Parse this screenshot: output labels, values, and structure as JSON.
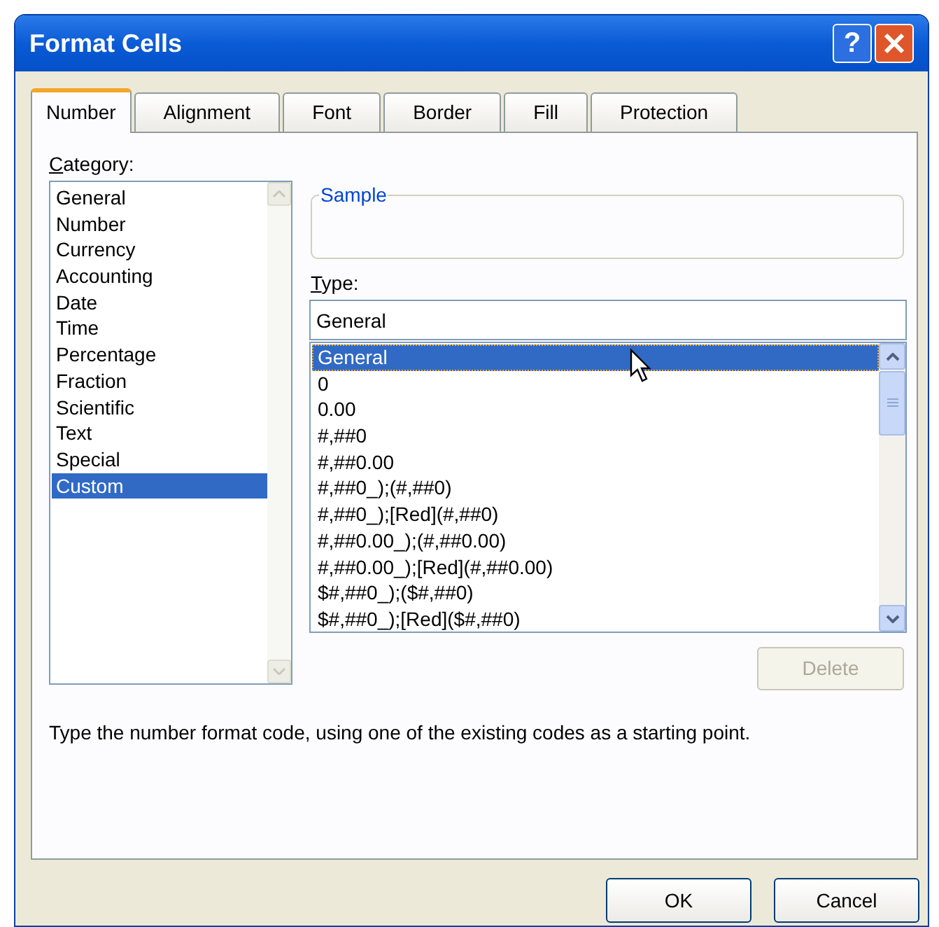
{
  "window": {
    "title": "Format Cells",
    "help_label": "?"
  },
  "tabs": [
    {
      "label": "Number",
      "selected": true
    },
    {
      "label": "Alignment",
      "selected": false
    },
    {
      "label": "Font",
      "selected": false
    },
    {
      "label": "Border",
      "selected": false
    },
    {
      "label": "Fill",
      "selected": false
    },
    {
      "label": "Protection",
      "selected": false
    }
  ],
  "category": {
    "label": "Category:",
    "items": [
      {
        "label": "General",
        "selected": false
      },
      {
        "label": "Number",
        "selected": false
      },
      {
        "label": "Currency",
        "selected": false
      },
      {
        "label": "Accounting",
        "selected": false
      },
      {
        "label": "Date",
        "selected": false
      },
      {
        "label": "Time",
        "selected": false
      },
      {
        "label": "Percentage",
        "selected": false
      },
      {
        "label": "Fraction",
        "selected": false
      },
      {
        "label": "Scientific",
        "selected": false
      },
      {
        "label": "Text",
        "selected": false
      },
      {
        "label": "Special",
        "selected": false
      },
      {
        "label": "Custom",
        "selected": true
      }
    ]
  },
  "sample": {
    "label": "Sample"
  },
  "type": {
    "label": "Type:",
    "value": "General",
    "items": [
      {
        "label": "General",
        "selected": true
      },
      {
        "label": "0",
        "selected": false
      },
      {
        "label": "0.00",
        "selected": false
      },
      {
        "label": "#,##0",
        "selected": false
      },
      {
        "label": "#,##0.00",
        "selected": false
      },
      {
        "label": "#,##0_);(#,##0)",
        "selected": false
      },
      {
        "label": "#,##0_);[Red](#,##0)",
        "selected": false
      },
      {
        "label": "#,##0.00_);(#,##0.00)",
        "selected": false
      },
      {
        "label": "#,##0.00_);[Red](#,##0.00)",
        "selected": false
      },
      {
        "label": "$#,##0_);($#,##0)",
        "selected": false
      },
      {
        "label": "$#,##0_);[Red]($#,##0)",
        "selected": false
      }
    ]
  },
  "delete_button": {
    "label": "Delete",
    "disabled": true
  },
  "description": "Type the number format code, using one of the existing codes as a starting point.",
  "buttons": [
    {
      "label": "OK"
    },
    {
      "label": "Cancel"
    }
  ]
}
